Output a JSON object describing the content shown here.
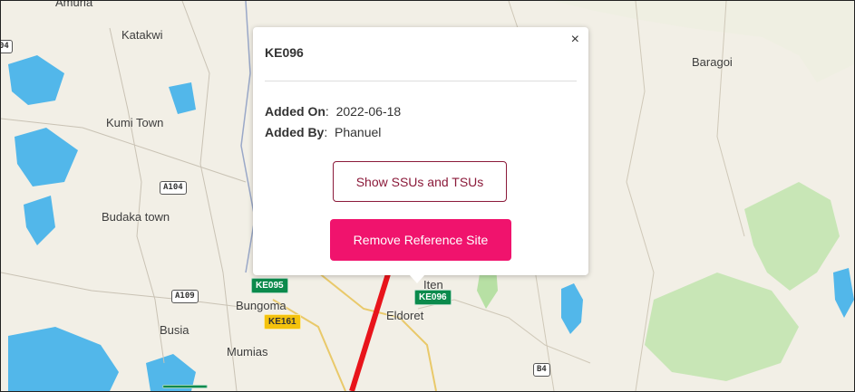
{
  "map": {
    "places": {
      "amuria": "Amuria",
      "katakwi": "Katakwi",
      "kumi_town": "Kumi Town",
      "budaka_town": "Budaka town",
      "busia": "Busia",
      "bungoma": "Bungoma",
      "mumias": "Mumias",
      "eldoret": "Eldoret",
      "iten": "Iten",
      "baragoi": "Baragoi"
    },
    "roads": {
      "r104_left": "04",
      "a104": "A104",
      "a109": "A109",
      "b4": "B4"
    },
    "sites": [
      {
        "label": "KE095",
        "color": "#0b8a4c"
      },
      {
        "label": "KE096",
        "color": "#0b8a4c"
      },
      {
        "label": "KE161",
        "color": "#f4c20d"
      },
      {
        "label": "",
        "color": "#0b8a4c"
      }
    ],
    "colors": {
      "land": "#f2efe6",
      "water": "#52b7ea",
      "park": "#c8e6b6",
      "annotation_arrow": "#e8141b"
    }
  },
  "popup": {
    "title": "KE096",
    "close_icon": "×",
    "added_on_label": "Added On",
    "added_on_value": "2022-06-18",
    "added_by_label": "Added By",
    "added_by_value": "Phanuel",
    "show_button": "Show SSUs and TSUs",
    "remove_button": "Remove Reference Site"
  }
}
